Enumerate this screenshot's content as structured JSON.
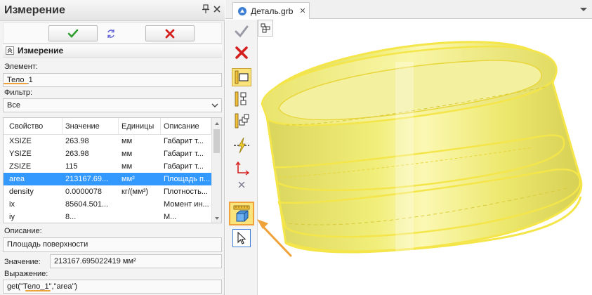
{
  "panel": {
    "title": "Измерение",
    "section_title": "Измерение",
    "element_label": "Элемент:",
    "element_value": "Тело_1",
    "filter_label": "Фильтр:",
    "filter_value": "Все",
    "table": {
      "columns": [
        "Свойство",
        "Значение",
        "Единицы",
        "Описание"
      ],
      "rows": [
        [
          "XSIZE",
          "263.98",
          "мм",
          "Габарит т..."
        ],
        [
          "YSIZE",
          "263.98",
          "мм",
          "Габарит т..."
        ],
        [
          "ZSIZE",
          "115",
          "мм",
          "Габарит т..."
        ],
        [
          "area",
          "213167.69...",
          "мм²",
          "Площадь п..."
        ],
        [
          "density",
          "0.0000078",
          "кг/(мм³)",
          "Плотность..."
        ],
        [
          "ix",
          "85604.501...",
          "",
          "Момент ин..."
        ],
        [
          "iy",
          "8...",
          "",
          "М..."
        ]
      ],
      "selected_row": 3
    },
    "description_label": "Описание:",
    "description_value": "Площадь поверхности",
    "value_label": "Значение:",
    "value_value": "213167.695022419 мм²",
    "expression_label": "Выражение:",
    "expression_value": "get(\"Тело_1\",\"area\")"
  },
  "document": {
    "tab_label": "Деталь.grb",
    "tab_close": "✕"
  },
  "icons": {
    "pin": "pin-icon",
    "close": "close-icon",
    "ok": "checkmark-icon",
    "refresh": "refresh-icon",
    "cancel": "cross-icon",
    "toolbar": [
      "checkmark-icon",
      "cross-icon",
      "frame-select-icon",
      "tree-select-icon",
      "multi-select-icon",
      "lightning-axis-icon",
      "coordinate-axes-icon",
      "measure-box-icon",
      "pointer-icon"
    ]
  },
  "colors": {
    "accent_orange": "#f0a23a",
    "selection_blue": "#3399ff",
    "ok_green": "#2e9e2e",
    "cancel_red": "#d52020",
    "body_yellow": "#f1ee7a",
    "highlight_yellow": "#fbe37c"
  }
}
